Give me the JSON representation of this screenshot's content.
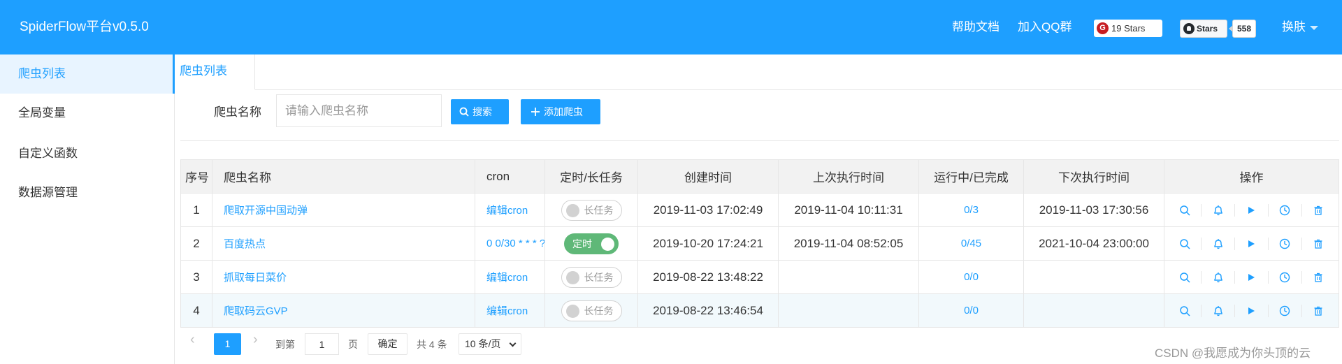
{
  "header": {
    "brand": "SpiderFlow平台v0.5.0",
    "nav": [
      "帮助文档",
      "加入QQ群"
    ],
    "gitee_badge": {
      "icon": "G",
      "label": "19 Stars"
    },
    "github_badge": {
      "label": "Stars",
      "count": "558"
    },
    "skin": "换肤"
  },
  "sidebar": {
    "items": [
      {
        "label": "爬虫列表"
      },
      {
        "label": "全局变量"
      },
      {
        "label": "自定义函数"
      },
      {
        "label": "数据源管理"
      }
    ]
  },
  "tabs": [
    {
      "label": "爬虫列表"
    }
  ],
  "search": {
    "label": "爬虫名称",
    "placeholder": "请输入爬虫名称",
    "search_button": "搜索",
    "add_button": "添加爬虫"
  },
  "table": {
    "headers": [
      "序号",
      "爬虫名称",
      "cron",
      "定时/长任务",
      "创建时间",
      "上次执行时间",
      "运行中/已完成",
      "下次执行时间",
      "操作"
    ],
    "rows": [
      {
        "idx": "1",
        "name": "爬取开源中国动弹",
        "cron": "编辑cron",
        "switch": "长任务",
        "switch_on": false,
        "created": "2019-11-03 17:02:49",
        "last_run": "2019-11-04 10:11:31",
        "status": "0/3",
        "next_run": "2019-11-03 17:30:56"
      },
      {
        "idx": "2",
        "name": "百度热点",
        "cron": "0 0/30 * * * ?",
        "switch": "定时",
        "switch_on": true,
        "created": "2019-10-20 17:24:21",
        "last_run": "2019-11-04 08:52:05",
        "status": "0/45",
        "next_run": "2021-10-04 23:00:00"
      },
      {
        "idx": "3",
        "name": "抓取每日菜价",
        "cron": "编辑cron",
        "switch": "长任务",
        "switch_on": false,
        "created": "2019-08-22 13:48:22",
        "last_run": "",
        "status": "0/0",
        "next_run": ""
      },
      {
        "idx": "4",
        "name": "爬取码云GVP",
        "cron": "编辑cron",
        "switch": "长任务",
        "switch_on": false,
        "created": "2019-08-22 13:46:54",
        "last_run": "",
        "status": "0/0",
        "next_run": ""
      }
    ],
    "action_icons": [
      "search-icon",
      "bell-icon",
      "play-icon",
      "clock-icon",
      "trash-icon"
    ]
  },
  "pagination": {
    "current_page": "1",
    "goto_label": "到第",
    "goto_value": "1",
    "page_unit": "页",
    "confirm": "确定",
    "total": "共 4 条",
    "page_size": "10 条/页"
  },
  "watermark": "CSDN @我愿成为你头顶的云",
  "colors": {
    "primary": "#1e9fff",
    "switch_on": "#5fb878",
    "link": "#1e9fff"
  }
}
